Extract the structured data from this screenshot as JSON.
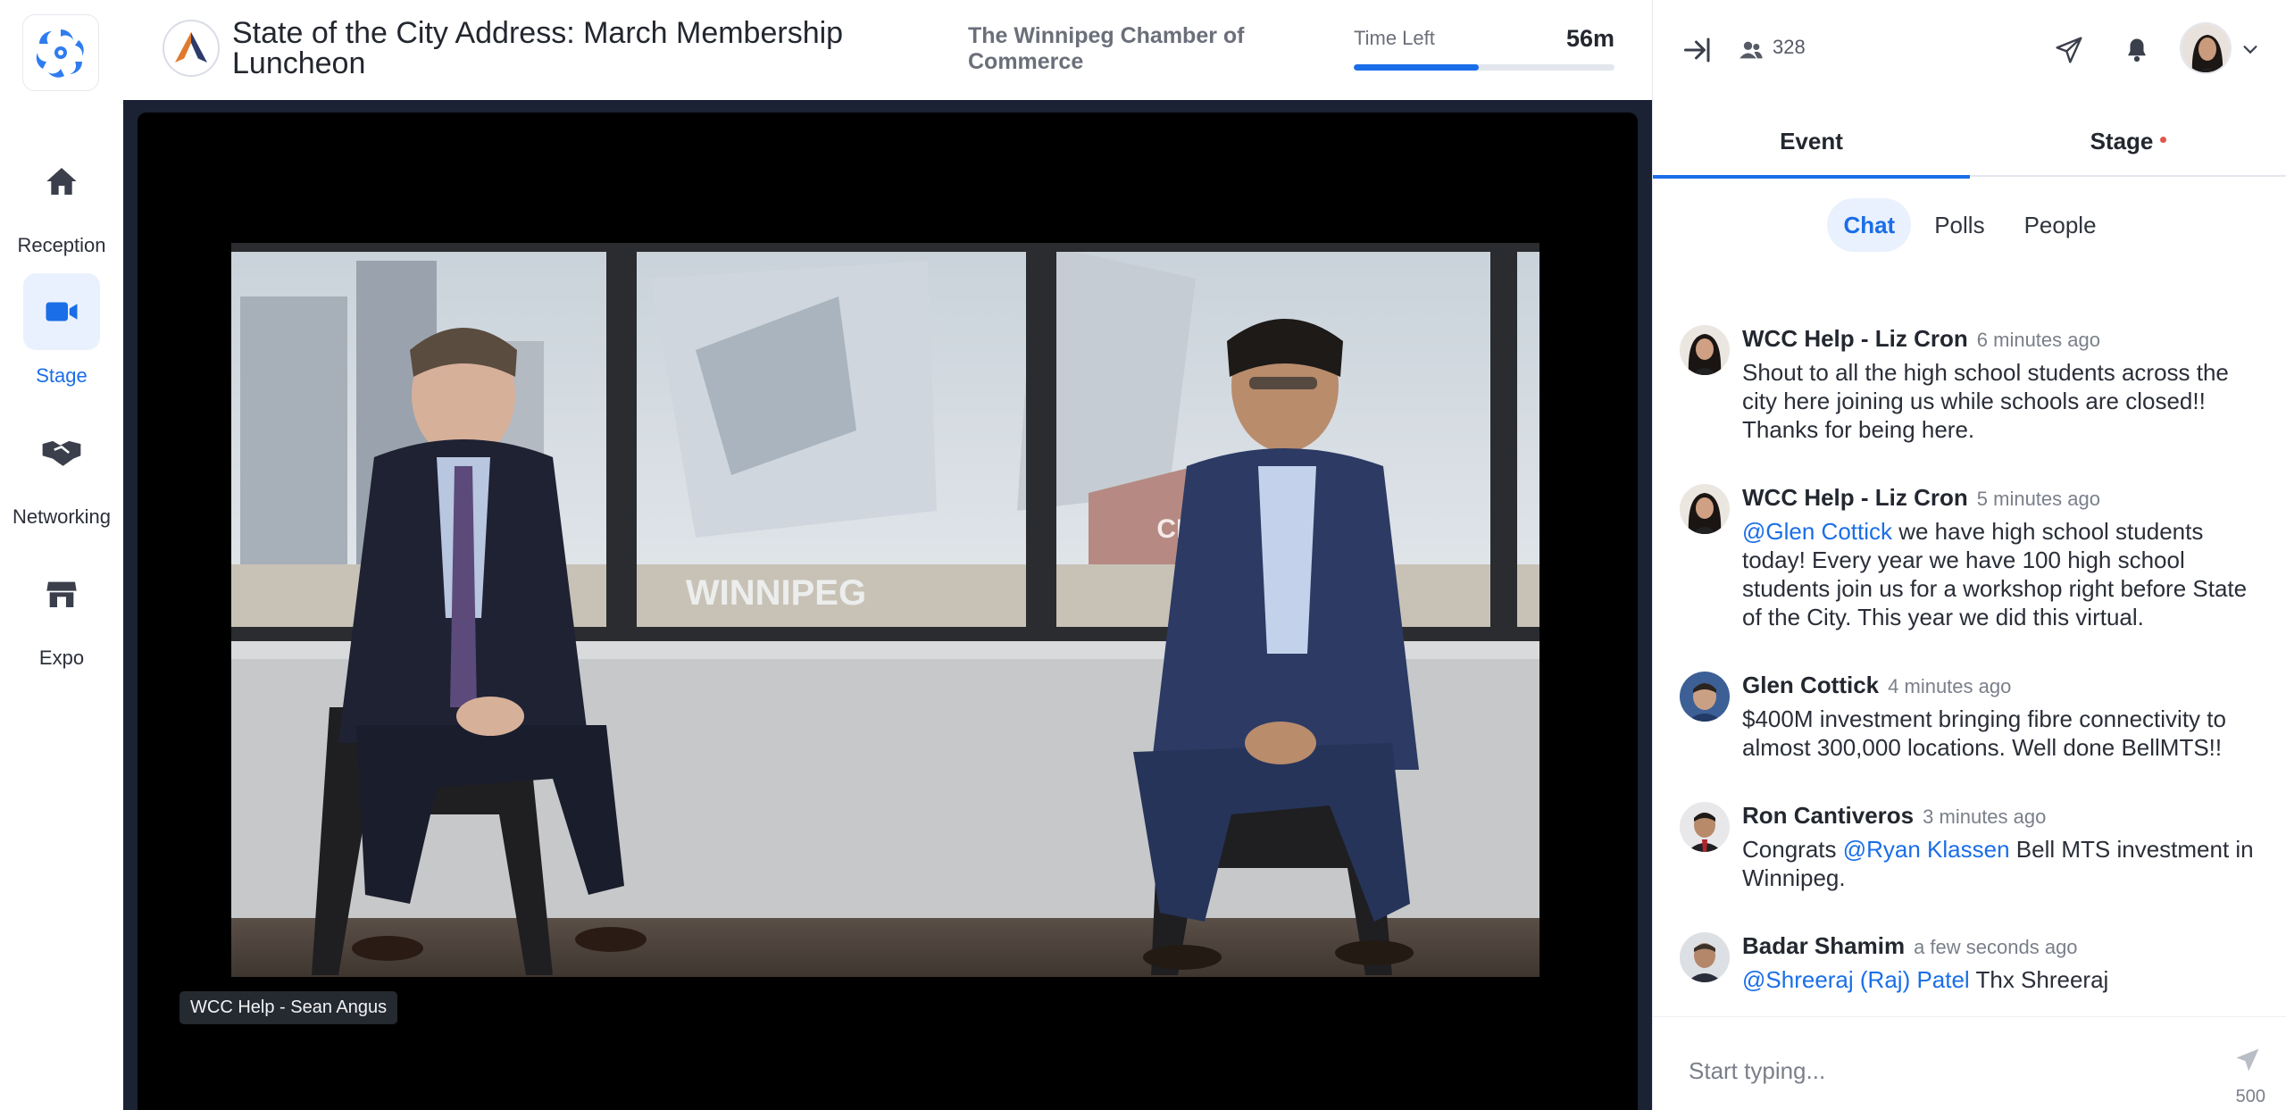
{
  "nav": {
    "items": [
      {
        "label": "Reception",
        "icon": "home-icon",
        "active": false
      },
      {
        "label": "Stage",
        "icon": "video-camera-icon",
        "active": true
      },
      {
        "label": "Networking",
        "icon": "handshake-icon",
        "active": false
      },
      {
        "label": "Expo",
        "icon": "storefront-icon",
        "active": false
      }
    ]
  },
  "header": {
    "title": "State of the City Address: March Membership Luncheon",
    "organizer": "The Winnipeg Chamber of Commerce",
    "time_left_label": "Time Left",
    "time_left_value": "56m",
    "time_progress": 0.48
  },
  "stage": {
    "speaker_tag": "WCC Help - Sean Angus",
    "video_overlay_text": "WINNIPEG",
    "video_sign_text": "CN"
  },
  "panel": {
    "attendee_count": "328",
    "tabs": [
      {
        "label": "Event",
        "active": true
      },
      {
        "label": "Stage",
        "active": false,
        "dot": true
      }
    ],
    "sub_tabs": [
      {
        "label": "Chat",
        "active": true
      },
      {
        "label": "Polls",
        "active": false
      },
      {
        "label": "People",
        "active": false
      }
    ]
  },
  "chat": {
    "messages": [
      {
        "name": "WCC Help - Liz Cron",
        "time": "6 minutes ago",
        "mention": "",
        "text": "Shout to all the high school students across the city here joining us while schools are closed!! Thanks for being here."
      },
      {
        "name": "WCC Help - Liz Cron",
        "time": "5 minutes ago",
        "mention": "@Glen Cottick",
        "text": " we have high school students today! Every year we have 100 high school students join us for a workshop right before State of the City. This year we did this virtual."
      },
      {
        "name": "Glen Cottick",
        "time": "4 minutes ago",
        "mention": "",
        "text": "$400M investment bringing fibre connectivity to almost 300,000 locations. Well done BellMTS!!"
      },
      {
        "name": "Ron Cantiveros",
        "time": "3 minutes ago",
        "mention_prefix": "Congrats ",
        "mention": "@Ryan Klassen",
        "text": " Bell MTS investment in Winnipeg."
      },
      {
        "name": "Badar Shamim",
        "time": "a few seconds ago",
        "mention": "@Shreeraj (Raj) Patel",
        "text": " Thx Shreeraj"
      }
    ],
    "input_placeholder": "Start typing...",
    "char_limit": "500"
  },
  "colors": {
    "accent": "#1a6ee8",
    "stage_bg": "#1b2233",
    "dot": "#e0564a"
  }
}
